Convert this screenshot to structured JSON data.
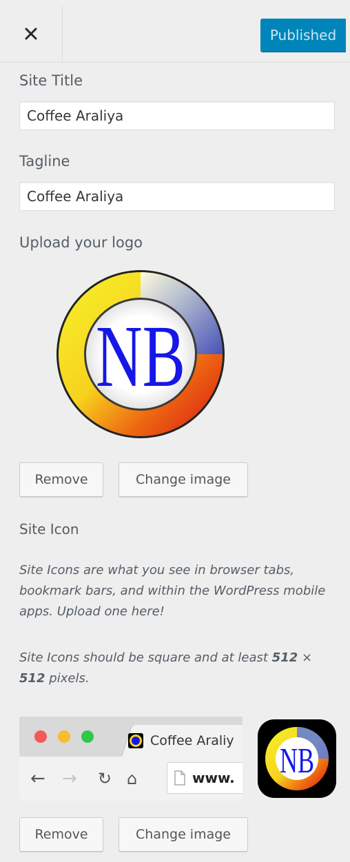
{
  "header": {
    "close_icon": "close-icon",
    "publish_label": "Published",
    "accent_color": "#0085ba"
  },
  "site_title": {
    "label": "Site Title",
    "value": "Coffee Araliya"
  },
  "tagline": {
    "label": "Tagline",
    "value": "Coffee Araliya"
  },
  "logo": {
    "label": "Upload your logo",
    "logo_text": "NB",
    "remove_label": "Remove",
    "change_label": "Change image"
  },
  "site_icon": {
    "label": "Site Icon",
    "description": "Site Icons are what you see in browser tabs, bookmark bars, and within the WordPress mobile apps. Upload one here!",
    "size_prefix": "Site Icons should be square and at least ",
    "size_value1": "512",
    "size_x": " × ",
    "size_value2": "512",
    "size_suffix": " pixels.",
    "preview": {
      "tab_title": "Coffee Araliy",
      "url": "www."
    },
    "remove_label": "Remove",
    "change_label": "Change image"
  }
}
